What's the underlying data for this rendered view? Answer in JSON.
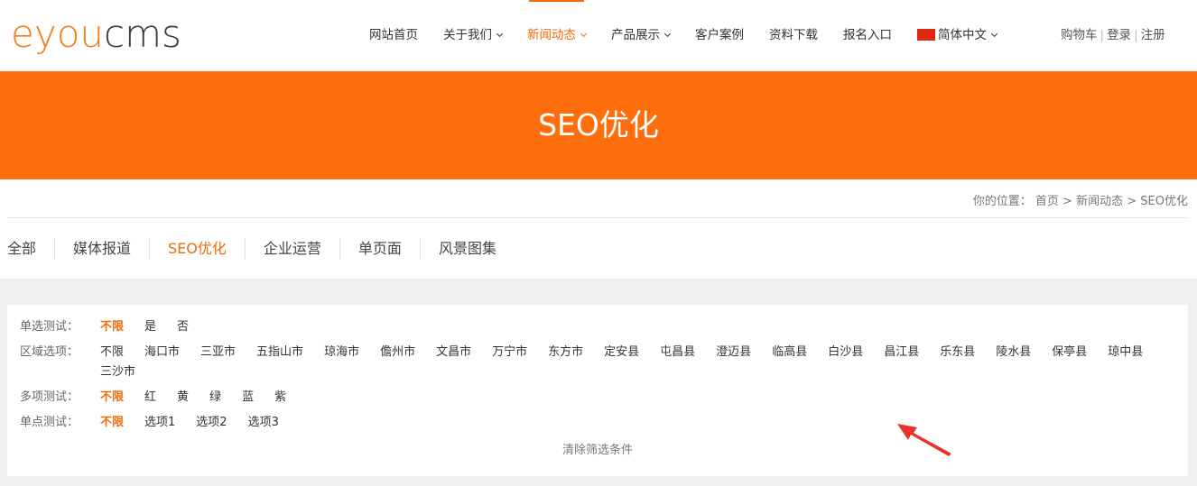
{
  "logo": {
    "part1": "eyou",
    "part2": "cms"
  },
  "nav": {
    "items": [
      {
        "label": "网站首页",
        "caret": false,
        "active": false
      },
      {
        "label": "关于我们",
        "caret": true,
        "active": false
      },
      {
        "label": "新闻动态",
        "caret": true,
        "active": true
      },
      {
        "label": "产品展示",
        "caret": true,
        "active": false
      },
      {
        "label": "客户案例",
        "caret": false,
        "active": false
      },
      {
        "label": "资料下载",
        "caret": false,
        "active": false
      },
      {
        "label": "报名入口",
        "caret": false,
        "active": false
      }
    ],
    "language": "简体中文",
    "cart": "购物车",
    "login": "登录",
    "register": "注册",
    "separator": "|"
  },
  "banner": {
    "title": "SEO优化"
  },
  "breadcrumb": {
    "prefix": "你的位置：",
    "home": "首页",
    "sep": ">",
    "section": "新闻动态",
    "current": "SEO优化"
  },
  "categories": [
    {
      "label": "全部",
      "active": false
    },
    {
      "label": "媒体报道",
      "active": false
    },
    {
      "label": "SEO优化",
      "active": true
    },
    {
      "label": "企业运营",
      "active": false
    },
    {
      "label": "单页面",
      "active": false
    },
    {
      "label": "风景图集",
      "active": false
    }
  ],
  "filters": [
    {
      "label": "单选测试：",
      "options": [
        "不限",
        "是",
        "否"
      ],
      "selected": 0
    },
    {
      "label": "区域选项：",
      "options": [
        "不限",
        "海口市",
        "三亚市",
        "五指山市",
        "琼海市",
        "儋州市",
        "文昌市",
        "万宁市",
        "东方市",
        "定安县",
        "屯昌县",
        "澄迈县",
        "临高县",
        "白沙县",
        "昌江县",
        "乐东县",
        "陵水县",
        "保亭县",
        "琼中县",
        "三沙市"
      ],
      "selected": -1
    },
    {
      "label": "多项测试：",
      "options": [
        "不限",
        "红",
        "黄",
        "绿",
        "蓝",
        "紫"
      ],
      "selected": 0
    },
    {
      "label": "单点测试：",
      "options": [
        "不限",
        "选项1",
        "选项2",
        "选项3"
      ],
      "selected": 0
    }
  ],
  "clear_filters": "清除筛选条件",
  "colors": {
    "accent": "#f26b0a",
    "banner": "#ff6e0c",
    "annotation_arrow": "#e8322d"
  }
}
